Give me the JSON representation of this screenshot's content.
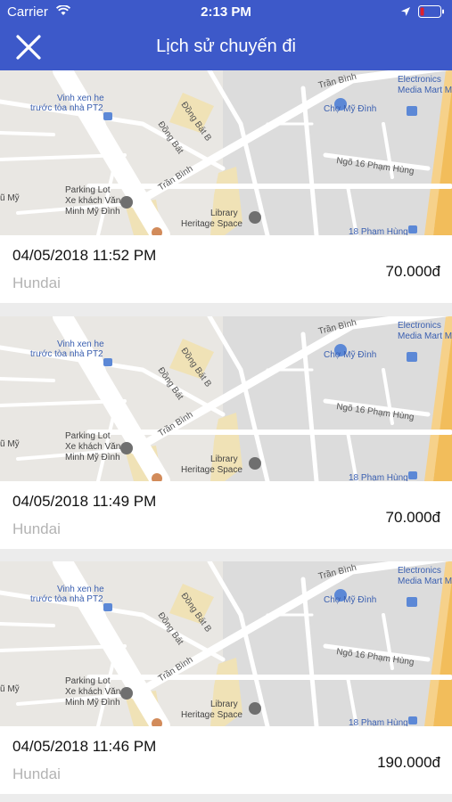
{
  "status_bar": {
    "carrier": "Carrier",
    "time": "2:13 PM"
  },
  "header": {
    "title": "Lịch sử chuyến đi"
  },
  "map_labels": {
    "tran_binh_top": "Trần Bình",
    "electronics_1": "Electronics",
    "electronics_2": "Media Mart M",
    "cho_my_dinh": "Chợ Mỹ Đình",
    "dong_bat_b": "Đồng Bát B",
    "dong_bat": "Đồng Bát",
    "vinh_xen_1": "Vinh xen he",
    "vinh_xen_2": "trước tòa nhà PT2",
    "ngo16": "Ngõ 16 Phạm Hùng",
    "tran_binh_mid": "Trần Bình",
    "parking_1": "Parking Lot",
    "parking_2": "Xe khách Văn",
    "parking_3": "Minh Mỹ Đình",
    "library_1": "Library",
    "library_2": "Heritage Space",
    "pham_hung": "18 Phạm Hùng",
    "u_my": "ũ Mỹ"
  },
  "trips": [
    {
      "datetime": "04/05/2018 11:52 PM",
      "car": "Hundai",
      "price": "70.000đ"
    },
    {
      "datetime": "04/05/2018 11:49 PM",
      "car": "Hundai",
      "price": "70.000đ"
    },
    {
      "datetime": "04/05/2018 11:46 PM",
      "car": "Hundai",
      "price": "190.000đ"
    }
  ],
  "colors": {
    "header": "#3d59c9",
    "muted_text": "#b3b3b3",
    "map_road": "#ffffff",
    "map_highway": "#f2bd5b"
  }
}
